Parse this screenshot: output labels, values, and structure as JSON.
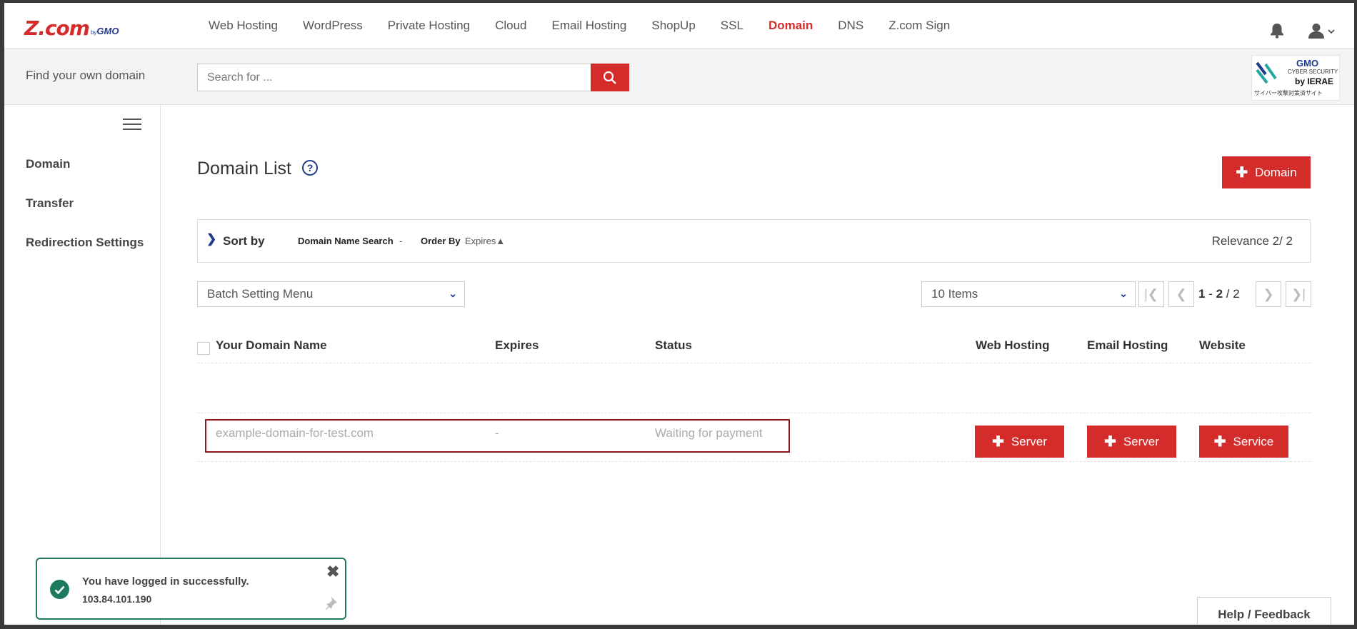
{
  "brand": {
    "logo_main": "Z.com",
    "logo_by": "by",
    "logo_gmo": "GMO"
  },
  "nav": {
    "items": [
      {
        "label": "Web Hosting",
        "active": false
      },
      {
        "label": "WordPress",
        "active": false
      },
      {
        "label": "Private Hosting",
        "active": false
      },
      {
        "label": "Cloud",
        "active": false
      },
      {
        "label": "Email Hosting",
        "active": false
      },
      {
        "label": "ShopUp",
        "active": false
      },
      {
        "label": "SSL",
        "active": false
      },
      {
        "label": "Domain",
        "active": true
      },
      {
        "label": "DNS",
        "active": false
      },
      {
        "label": "Z.com Sign",
        "active": false
      }
    ]
  },
  "search": {
    "label": "Find your own domain",
    "placeholder": "Search for ..."
  },
  "security_badge": {
    "brand": "GMO",
    "line1": "CYBER SECURITY",
    "line2": "by IERAE",
    "line3": "サイバー攻撃対策済サイト"
  },
  "sidebar": {
    "items": [
      {
        "label": "Domain"
      },
      {
        "label": "Transfer"
      },
      {
        "label": "Redirection Settings"
      }
    ]
  },
  "main": {
    "title": "Domain List",
    "help_glyph": "?",
    "add_button": "Domain",
    "sort": {
      "label": "Sort by",
      "search_label": "Domain Name Search",
      "search_value": "-",
      "order_label": "Order By",
      "order_value": "Expires▲",
      "relevance": "Relevance 2/ 2"
    },
    "batch_menu": "Batch Setting Menu",
    "items_per_page": "10 Items",
    "pager": {
      "first": "|❮",
      "prev": "❮",
      "next": "❯",
      "last": "❯|",
      "range_start": "1",
      "range_sep": " - ",
      "range_end": "2",
      "total_sep": " / ",
      "total": "2"
    },
    "table": {
      "headers": {
        "domain": "Your Domain Name",
        "expires": "Expires",
        "status": "Status",
        "web_hosting": "Web Hosting",
        "email_hosting": "Email Hosting",
        "website": "Website"
      },
      "rows": [
        {
          "domain": "example-domain-for-test.com",
          "expires": "-",
          "status": "Waiting for payment",
          "web_hosting_btn": "Server",
          "email_hosting_btn": "Server",
          "website_btn": "Service"
        }
      ]
    }
  },
  "toast": {
    "message": "You have logged in successfully.",
    "ip": "103.84.101.190"
  },
  "feedback": "Help / Feedback",
  "colors": {
    "accent": "#d42b2b",
    "brand_blue": "#1e3a8a",
    "success": "#1e7a5f",
    "highlight": "#8b1a1a"
  }
}
